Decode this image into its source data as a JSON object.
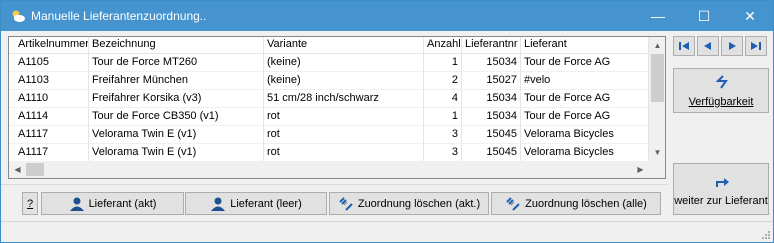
{
  "window": {
    "title": "Manuelle Lieferantenzuordnung..",
    "controls": {
      "minimize": "—",
      "maximize": "☐",
      "close": "✕"
    }
  },
  "grid": {
    "columns": [
      "Artikelnummer",
      "Bezeichnung",
      "Variante",
      "Anzahl",
      "Lieferantnr",
      "Lieferant"
    ],
    "rows": [
      [
        "A1105",
        "Tour de Force MT260",
        "(keine)",
        "1",
        "15034",
        "Tour de Force AG"
      ],
      [
        "A1103",
        "Freifahrer München",
        "(keine)",
        "2",
        "15027",
        "#velo"
      ],
      [
        "A1110",
        "Freifahrer Korsika (v3)",
        "51 cm/28 inch/schwarz",
        "4",
        "15034",
        "Tour de Force AG"
      ],
      [
        "A1114",
        "Tour de Force CB350 (v1)",
        "rot",
        "1",
        "15034",
        "Tour de Force AG"
      ],
      [
        "A1117",
        "Velorama Twin E (v1)",
        "rot",
        "3",
        "15045",
        "Velorama Bicycles"
      ],
      [
        "A1117",
        "Velorama Twin E (v1)",
        "rot",
        "3",
        "15045",
        "Velorama Bicycles"
      ]
    ],
    "scroll_arrows": {
      "up": "▲",
      "down": "▼",
      "left": "◀",
      "right": "▶"
    }
  },
  "side": {
    "availability_label": "Verfügbarkeit",
    "next_supplier_label": "weiter zur Lieferant"
  },
  "bottom": {
    "help_label": "?",
    "supplier_current_label": "Lieferant (akt)",
    "supplier_empty_label": "Lieferant (leer)",
    "clear_current_label": "Zuordnung löschen (akt.)",
    "clear_all_label": "Zuordnung löschen (alle)"
  },
  "icons": {
    "app": "cloud-sun-icon",
    "nav_first": "first-record-icon",
    "nav_prev": "previous-record-icon",
    "nav_next": "next-record-icon",
    "nav_last": "last-record-icon",
    "availability": "refresh-arrows-icon",
    "next_supplier": "forward-arrow-icon",
    "person": "person-icon",
    "clear": "unlink-icon"
  },
  "colors": {
    "titlebar": "#4593cf",
    "nav_icon": "#1e5fb4",
    "person_icon": "#1c4f8f"
  }
}
